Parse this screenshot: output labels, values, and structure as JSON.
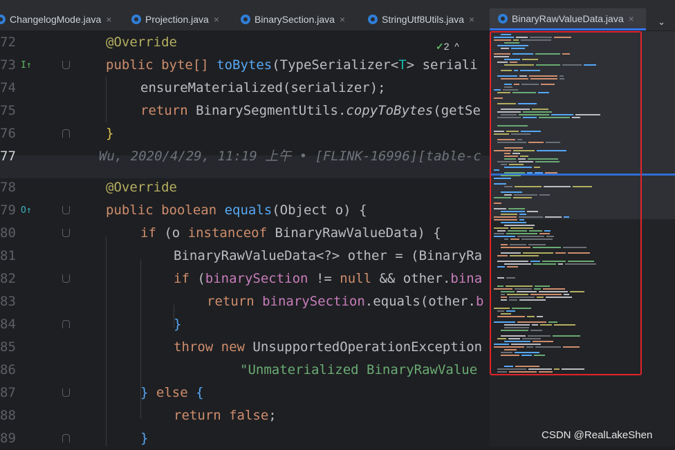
{
  "tabs": [
    {
      "label": "ChangelogMode.java",
      "active": false
    },
    {
      "label": "Projection.java",
      "active": false
    },
    {
      "label": "BinarySection.java",
      "active": false
    },
    {
      "label": "StringUtf8Utils.java",
      "active": false
    },
    {
      "label": "BinaryRawValueData.java",
      "active": true
    }
  ],
  "close_glyph": "×",
  "tab_overflow_glyph": "⌄",
  "inspection": {
    "count": "2",
    "ok_glyph": "✓"
  },
  "gutter": {
    "override_icon": "O↑",
    "impl_icon": "I↑"
  },
  "lines": [
    {
      "num": "72"
    },
    {
      "num": "73"
    },
    {
      "num": "74"
    },
    {
      "num": "75"
    },
    {
      "num": "76"
    },
    {
      "num": "77"
    },
    {
      "num": "78"
    },
    {
      "num": "79"
    },
    {
      "num": "80"
    },
    {
      "num": "81"
    },
    {
      "num": "82"
    },
    {
      "num": "83"
    },
    {
      "num": "84"
    },
    {
      "num": "85"
    },
    {
      "num": "86"
    },
    {
      "num": "87"
    },
    {
      "num": "88"
    },
    {
      "num": "89"
    }
  ],
  "code": {
    "l72": "@Override",
    "l73_a": "public byte[] ",
    "l73_fn": "toBytes",
    "l73_b": "(TypeSerializer<",
    "l73_t": "T",
    "l73_c": "> seriali",
    "l74": "ensureMaterialized(serializer);",
    "l75_kw": "return ",
    "l75_a": "BinarySegmentUtils.",
    "l75_it": "copyToBytes",
    "l75_b": "(getSe",
    "l76": "}",
    "l77_lens": "Wu, 2020/4/29, 11:19 上午 • [FLINK-16996][table-c",
    "l78": "@Override",
    "l79_kw": "public boolean ",
    "l79_fn": "equals",
    "l79_b": "(Object o) {",
    "l80_kw": "if ",
    "l80_a": "(o ",
    "l80_kw2": "instanceof ",
    "l80_b": "BinaryRawValueData) {",
    "l81_a": "BinaryRawValueData<?> other = (BinaryRa",
    "l82_kw": "if ",
    "l82_a": "(",
    "l82_f": "binarySection",
    "l82_b": " != ",
    "l82_kw2": "null ",
    "l82_c": "&& other.",
    "l82_f2": "bina",
    "l83_kw": "return ",
    "l83_f": "binarySection",
    "l83_a": ".equals(other.",
    "l83_f2": "b",
    "l84": "}",
    "l85_kw": "throw new ",
    "l85_a": "UnsupportedOperationException",
    "l86": "\"Unmaterialized BinaryRawValue",
    "l87_a": "} ",
    "l87_kw": "else ",
    "l87_b": "{",
    "l88_kw": "return false",
    "l88_a": ";",
    "l89": "}"
  },
  "watermark": "CSDN @RealLakeShen",
  "colors": {
    "accent": "#3574f0",
    "highlight_box": "#e3242b"
  }
}
